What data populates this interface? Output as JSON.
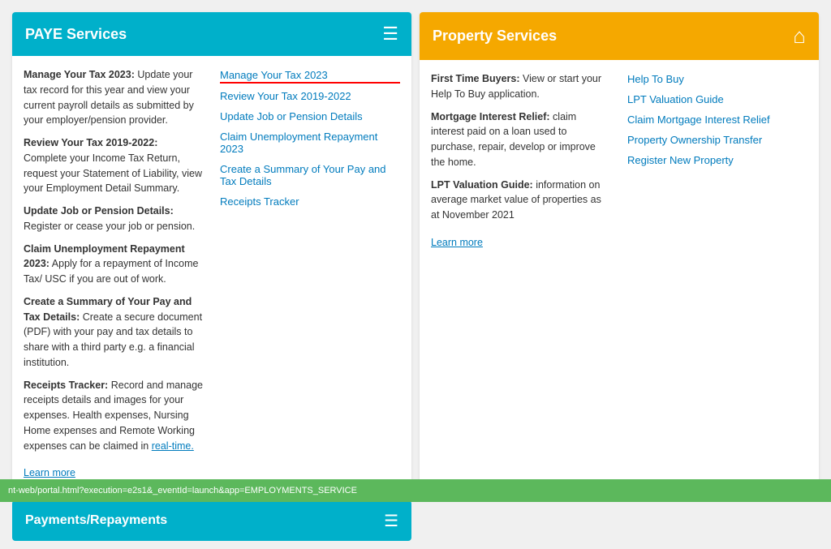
{
  "paye": {
    "header_title": "PAYE Services",
    "header_icon": "☰",
    "desc_items": [
      {
        "label": "Manage Your Tax 2023:",
        "text": " Update your tax record for this year and view your current payroll details as submitted by your employer/pension provider."
      },
      {
        "label": "Review Your Tax 2019-2022:",
        "text": " Complete your Income Tax Return, request your Statement of Liability, view your Employment Detail Summary."
      },
      {
        "label": "Update Job or Pension Details:",
        "text": " Register or cease your job or pension."
      },
      {
        "label": "Claim Unemployment Repayment 2023:",
        "text": " Apply for a repayment of Income Tax/ USC if you are out of work."
      },
      {
        "label": "Create a Summary of Your Pay and Tax Details:",
        "text": " Create a secure document (PDF) with your pay and tax details to share with a third party e.g. a financial institution."
      },
      {
        "label": "Receipts Tracker:",
        "text": " Record and manage receipts details and images for your expenses. Health expenses, Nursing Home expenses and Remote Working expenses can be claimed in real-time."
      }
    ],
    "learn_more": "Learn more",
    "links": [
      {
        "text": "Manage Your Tax 2023",
        "active": true
      },
      {
        "text": "Review Your Tax 2019-2022",
        "active": false
      },
      {
        "text": "Update Job or Pension Details",
        "active": false
      },
      {
        "text": "Claim Unemployment Repayment 2023",
        "active": false
      },
      {
        "text": "Create a Summary of Your Pay and Tax Details",
        "active": false
      },
      {
        "text": "Receipts Tracker",
        "active": false
      }
    ]
  },
  "property": {
    "header_title": "Property Services",
    "header_icon": "⌂",
    "desc_items": [
      {
        "label": "First Time Buyers:",
        "text": " View or start your Help To Buy application."
      },
      {
        "label": "Mortgage Interest Relief:",
        "text": " claim interest paid on a loan used to purchase, repair, develop or improve the home."
      },
      {
        "label": "LPT Valuation Guide:",
        "text": " information on average market value of properties as at November 2021"
      }
    ],
    "learn_more": "Learn more",
    "links": [
      {
        "text": "Help To Buy",
        "active": false
      },
      {
        "text": "LPT Valuation Guide",
        "active": false
      },
      {
        "text": "Claim Mortgage Interest Relief",
        "active": false
      },
      {
        "text": "Property Ownership Transfer",
        "active": false
      },
      {
        "text": "Register New Property",
        "active": false
      }
    ]
  },
  "bottom_cards": [
    {
      "title": "Payments/Repayments",
      "icon": "☰"
    }
  ],
  "status_bar": {
    "url": "nt-web/portal.html?execution=e2s1&_eventId=launch&app=EMPLOYMENTS_SERVICE"
  }
}
